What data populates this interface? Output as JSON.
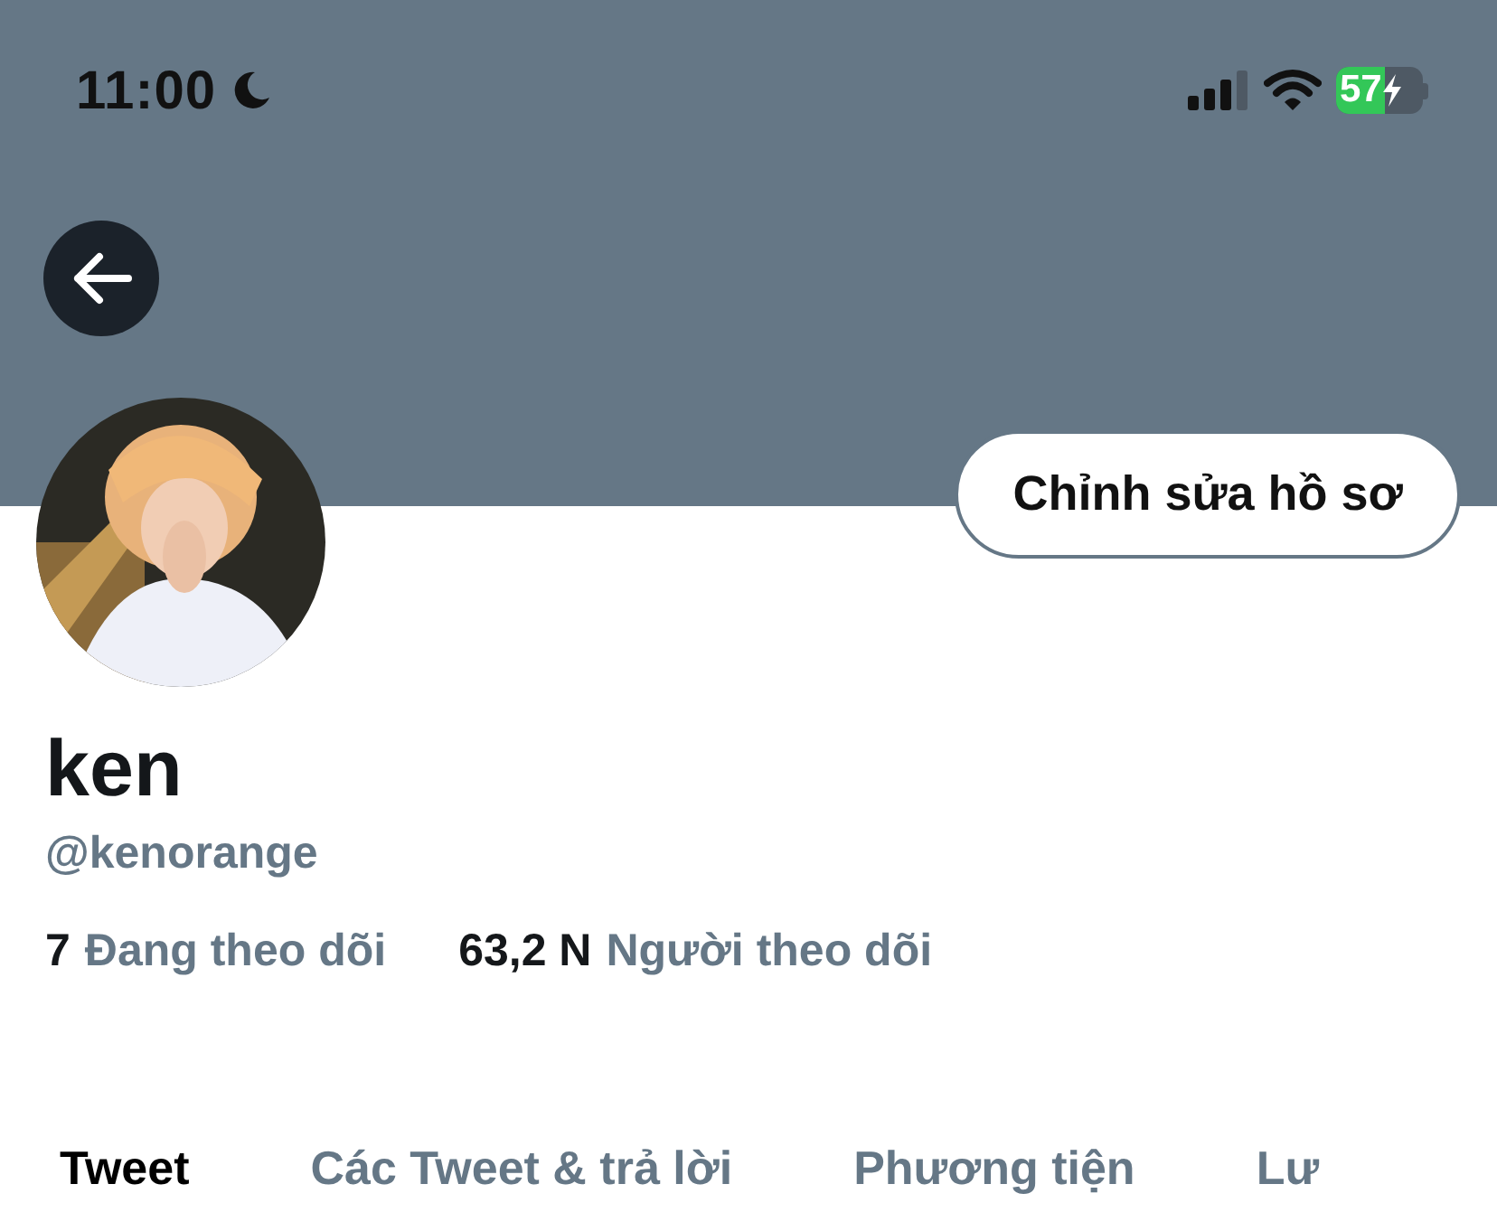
{
  "status_bar": {
    "time": "11:00",
    "battery": "57",
    "charging": true,
    "do_not_disturb": true
  },
  "profile": {
    "name": "ken",
    "handle": "@kenorange",
    "edit_button": "Chỉnh sửa hồ sơ",
    "stats": [
      {
        "count": "7",
        "label": "Đang theo dõi"
      },
      {
        "count": "63,2 N",
        "label": "Người theo dõi"
      }
    ]
  },
  "tabs": [
    {
      "label": "Tweet",
      "selected": true
    },
    {
      "label": "Các Tweet & trả lời",
      "selected": false
    },
    {
      "label": "Phương tiện",
      "selected": false
    },
    {
      "label": "Lư",
      "selected": false
    }
  ]
}
